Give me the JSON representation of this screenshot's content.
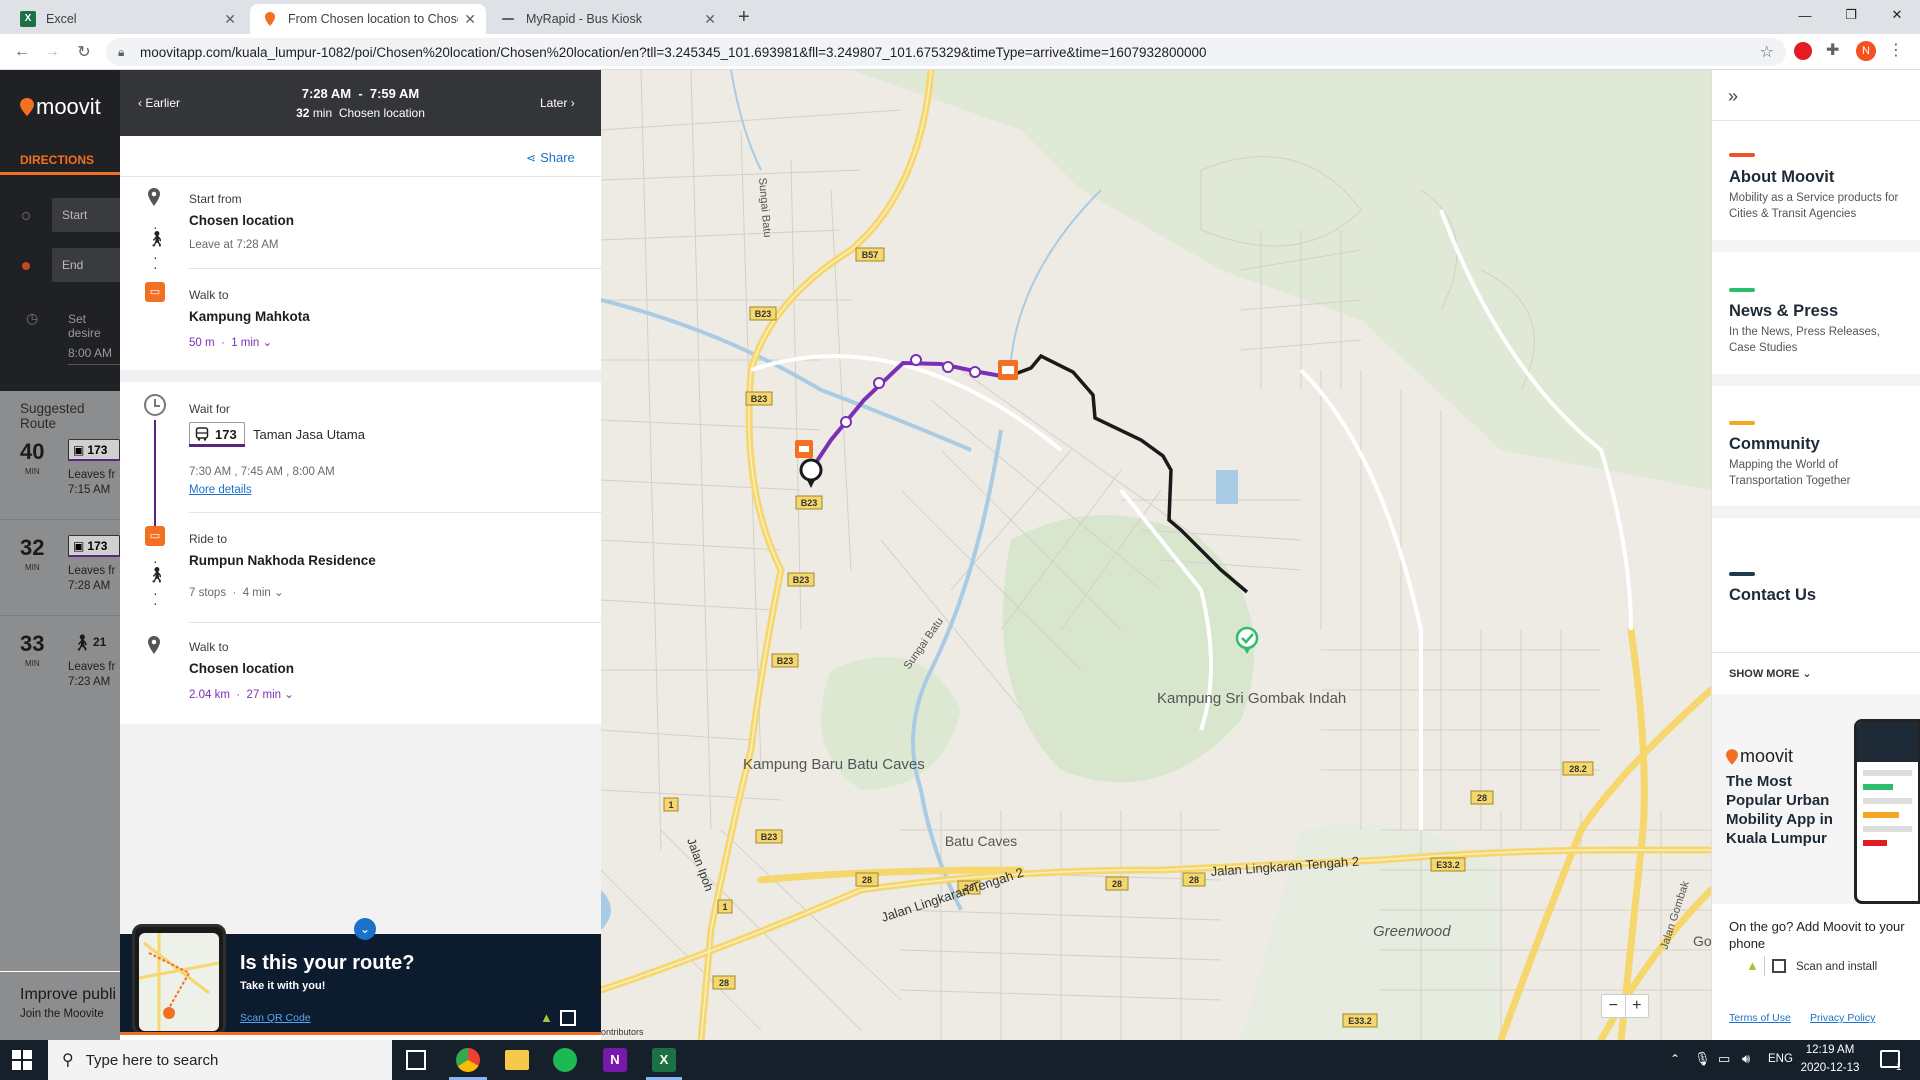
{
  "browser": {
    "tabs": [
      {
        "label": "Excel",
        "icon": "excel-icon"
      },
      {
        "label": "From Chosen location to Chosen",
        "icon": "moovit-pin-icon"
      },
      {
        "label": "MyRapid - Bus Kiosk",
        "icon": "dash-icon"
      }
    ],
    "url": "moovitapp.com/kuala_lumpur-1082/poi/Chosen%20location/Chosen%20location/en?tll=3.245345_101.693981&fll=3.249807_101.675329&timeType=arrive&time=1607932800000",
    "profile_initial": "N"
  },
  "moovit_side": {
    "logo": "moovit",
    "directions_label": "DIRECTIONS",
    "start_placeholder": "Start",
    "end_placeholder": "End",
    "set_desired": "Set desire",
    "time": "8:00 AM",
    "suggested_routes": "Suggested Route",
    "routes": [
      {
        "minutes": "40",
        "unit": "MIN",
        "line": "173",
        "leaves": "Leaves fr",
        "time": "7:15 AM"
      },
      {
        "minutes": "32",
        "unit": "MIN",
        "line": "173",
        "leaves": "Leaves fr",
        "time": "7:28 AM"
      },
      {
        "minutes": "33",
        "unit": "MIN",
        "line": "21",
        "leaves": "Leaves fr",
        "time": "7:23 AM"
      }
    ],
    "improve_title": "Improve publi",
    "improve_sub": "Join the Moovite"
  },
  "route_header": {
    "earlier": "Earlier",
    "later": "Later",
    "time_range": "7:28 AM  -  7:59 AM",
    "duration": "32",
    "duration_unit": "min",
    "destination": "Chosen location",
    "share": "Share",
    "close": "×"
  },
  "steps": {
    "start_label": "Start from",
    "start_place": "Chosen location",
    "start_leave": "Leave at 7:28 AM",
    "walk1_label": "Walk to",
    "walk1_place": "Kampung Mahkota",
    "walk1_dist": "50 m",
    "walk1_time": "1 min",
    "wait_label": "Wait for",
    "bus_line": "173",
    "bus_dest": "Taman Jasa Utama",
    "bus_times": "7:30 AM , 7:45 AM , 8:00 AM",
    "more_details": "More details",
    "ride_label": "Ride to",
    "ride_place": "Rumpun Nakhoda Residence",
    "ride_stops": "7 stops",
    "ride_time": "4 min",
    "walk2_label": "Walk to",
    "walk2_place": "Chosen location",
    "walk2_dist": "2.04 km",
    "walk2_time": "27 min"
  },
  "promo": {
    "title": "Is this your route?",
    "subtitle": "Take it with you!",
    "qr_link": "Scan QR Code"
  },
  "map": {
    "labels": [
      "Kampung Sri Gombak Indah",
      "Kampung Baru Batu Caves",
      "Batu Caves",
      "Greenwood",
      "Jalan Lingkaran Tengah 2",
      "Jalan Lingkaran Tengah 2",
      "Jalan Ipoh",
      "Sungai Batu",
      "Sungai Batu",
      "Jalan Gombak",
      "ontributors",
      "Go"
    ],
    "road_badges": [
      "B57",
      "B23",
      "B23",
      "B23",
      "B23",
      "B23",
      "B23",
      "28",
      "28",
      "28",
      "28",
      "28",
      "28",
      "E33.2",
      "E33.2",
      "1",
      "1",
      "28.2"
    ],
    "zoom_out": "−",
    "zoom_in": "+"
  },
  "right_panel": {
    "items": [
      {
        "title": "About Moovit",
        "sub": "Mobility as a Service products for Cities & Transit Agencies",
        "color": "#f0502d"
      },
      {
        "title": "News & Press",
        "sub": "In the News, Press Releases, Case Studies",
        "color": "#2dbe6c"
      },
      {
        "title": "Community",
        "sub": "Mapping the World of Transportation Together",
        "color": "#f5a623"
      },
      {
        "title": "Contact Us",
        "sub": "",
        "color": "#1e3a4c"
      }
    ],
    "show_more": "SHOW MORE",
    "ad_brand": "moovit",
    "ad_text": "The Most Popular Urban Mobility App in Kuala Lumpur",
    "on_the_go": "On the go? Add Moovit to your phone",
    "scan_install": "Scan and install",
    "terms": "Terms of Use",
    "privacy": "Privacy Policy"
  },
  "taskbar": {
    "search_placeholder": "Type here to search",
    "lang": "ENG",
    "time": "12:19 AM",
    "date": "2020-12-13",
    "notif_count": "1"
  },
  "colors": {
    "moovit_orange": "#f36f21",
    "bus_purple": "#7b2fb4",
    "walk_black": "#1a1a1a",
    "link_blue": "#1a73c8"
  }
}
